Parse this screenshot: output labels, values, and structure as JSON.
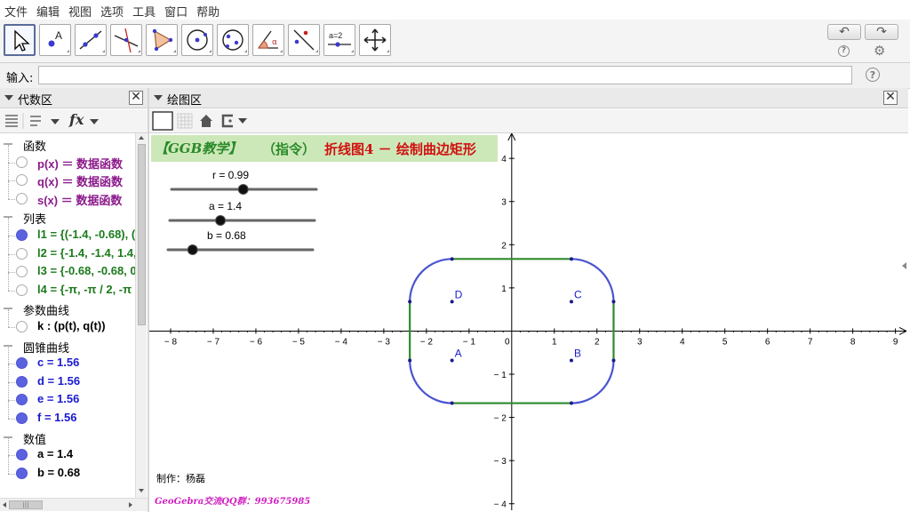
{
  "menu": [
    "文件",
    "编辑",
    "视图",
    "选项",
    "工具",
    "窗口",
    "帮助"
  ],
  "toolbar": {
    "tools": [
      "move",
      "point",
      "line",
      "perpendicular",
      "polygon",
      "circle",
      "conic",
      "angle",
      "reflect",
      "slider",
      "move-graphics"
    ],
    "slider_tool_label": "a=2",
    "undo_icon": "↶",
    "redo_icon": "↷",
    "help_glyph": "?",
    "settings_icon": "⚙"
  },
  "input": {
    "label": "输入:",
    "value": "",
    "help_glyph": "?"
  },
  "algebra": {
    "title": "代数区",
    "close": "✕",
    "fx_label": "fx",
    "rows": [
      {
        "kind": "cat",
        "text": "函数"
      },
      {
        "kind": "item",
        "state": "off",
        "text": "p(x) ＝ 数据函数",
        "color": "#8b1a8b"
      },
      {
        "kind": "item",
        "state": "off",
        "text": "q(x) ＝ 数据函数",
        "color": "#8b1a8b"
      },
      {
        "kind": "item",
        "state": "off",
        "text": "s(x) ＝ 数据函数",
        "color": "#8b1a8b"
      },
      {
        "kind": "cat",
        "text": "列表"
      },
      {
        "kind": "item",
        "state": "on",
        "text": "l1 = {(-1.4, -0.68), (",
        "color": "#1c7a1c"
      },
      {
        "kind": "item",
        "state": "off",
        "text": "l2 = {-1.4, -1.4, 1.4,",
        "color": "#1c7a1c"
      },
      {
        "kind": "item",
        "state": "off",
        "text": "l3 = {-0.68, -0.68, 0.",
        "color": "#1c7a1c"
      },
      {
        "kind": "item",
        "state": "off",
        "text": "l4 = {-π, -π / 2, -π /",
        "color": "#1c7a1c"
      },
      {
        "kind": "cat",
        "text": "参数曲线"
      },
      {
        "kind": "item",
        "state": "off",
        "text": "k : (p(t), q(t))",
        "color": "#000000"
      },
      {
        "kind": "cat",
        "text": "圆锥曲线"
      },
      {
        "kind": "item",
        "state": "on",
        "text": "c = 1.56",
        "color": "#1a1ad0"
      },
      {
        "kind": "item",
        "state": "on",
        "text": "d = 1.56",
        "color": "#1a1ad0"
      },
      {
        "kind": "item",
        "state": "on",
        "text": "e = 1.56",
        "color": "#1a1ad0"
      },
      {
        "kind": "item",
        "state": "on",
        "text": "f = 1.56",
        "color": "#1a1ad0"
      },
      {
        "kind": "cat",
        "text": "数值"
      },
      {
        "kind": "item",
        "state": "on",
        "text": "a = 1.4",
        "color": "#000000"
      },
      {
        "kind": "item",
        "state": "on",
        "text": "b = 0.68",
        "color": "#000000"
      }
    ],
    "hscroll_grip": "|||"
  },
  "graphics": {
    "title": "绘图区",
    "close": "✕",
    "banner": {
      "part1": "【GGB教学】",
      "part2": "（指令）",
      "part3": "折线图4 － 绘制曲边矩形"
    },
    "sliders": [
      {
        "label": "r = 0.99",
        "min": 0,
        "max": 2,
        "value": 0.99
      },
      {
        "label": "a = 1.4",
        "min": 0,
        "max": 4,
        "value": 1.4
      },
      {
        "label": "b = 0.68",
        "min": 0,
        "max": 4,
        "value": 0.68
      }
    ],
    "author": "制作：杨磊",
    "qq": "GeoGebra交流QQ群：993675985",
    "points": [
      {
        "name": "A",
        "x": -1.4,
        "y": -0.68
      },
      {
        "name": "B",
        "x": 1.4,
        "y": -0.68
      },
      {
        "name": "C",
        "x": 1.4,
        "y": 0.68
      },
      {
        "name": "D",
        "x": -1.4,
        "y": 0.68
      }
    ],
    "colors": {
      "arc": "#4a55d0",
      "segment": "#2e8b2e",
      "point": "#1a1a8c",
      "banner_bg": "#cde8b8",
      "banner_red": "#d01010",
      "banner_green": "#2a8a2a",
      "qq": "#d020c0"
    }
  },
  "chart_data": {
    "type": "scatter",
    "x_ticks": [
      -8,
      -7,
      -6,
      -5,
      -4,
      -3,
      -2,
      -1,
      0,
      1,
      2,
      3,
      4,
      5,
      6,
      7,
      8,
      9
    ],
    "y_ticks": [
      -4,
      -3,
      -2,
      -1,
      1,
      2,
      3,
      4
    ],
    "xlim": [
      -8.5,
      9.3
    ],
    "ylim": [
      -4.15,
      4.58
    ],
    "points": [
      {
        "name": "A",
        "x": -1.4,
        "y": -0.68
      },
      {
        "name": "B",
        "x": 1.4,
        "y": -0.68
      },
      {
        "name": "C",
        "x": 1.4,
        "y": 0.68
      },
      {
        "name": "D",
        "x": -1.4,
        "y": 0.68
      }
    ],
    "curve": {
      "half_width": 1.4,
      "half_height": 0.68,
      "corner_radius": 0.99
    },
    "grid": false
  }
}
